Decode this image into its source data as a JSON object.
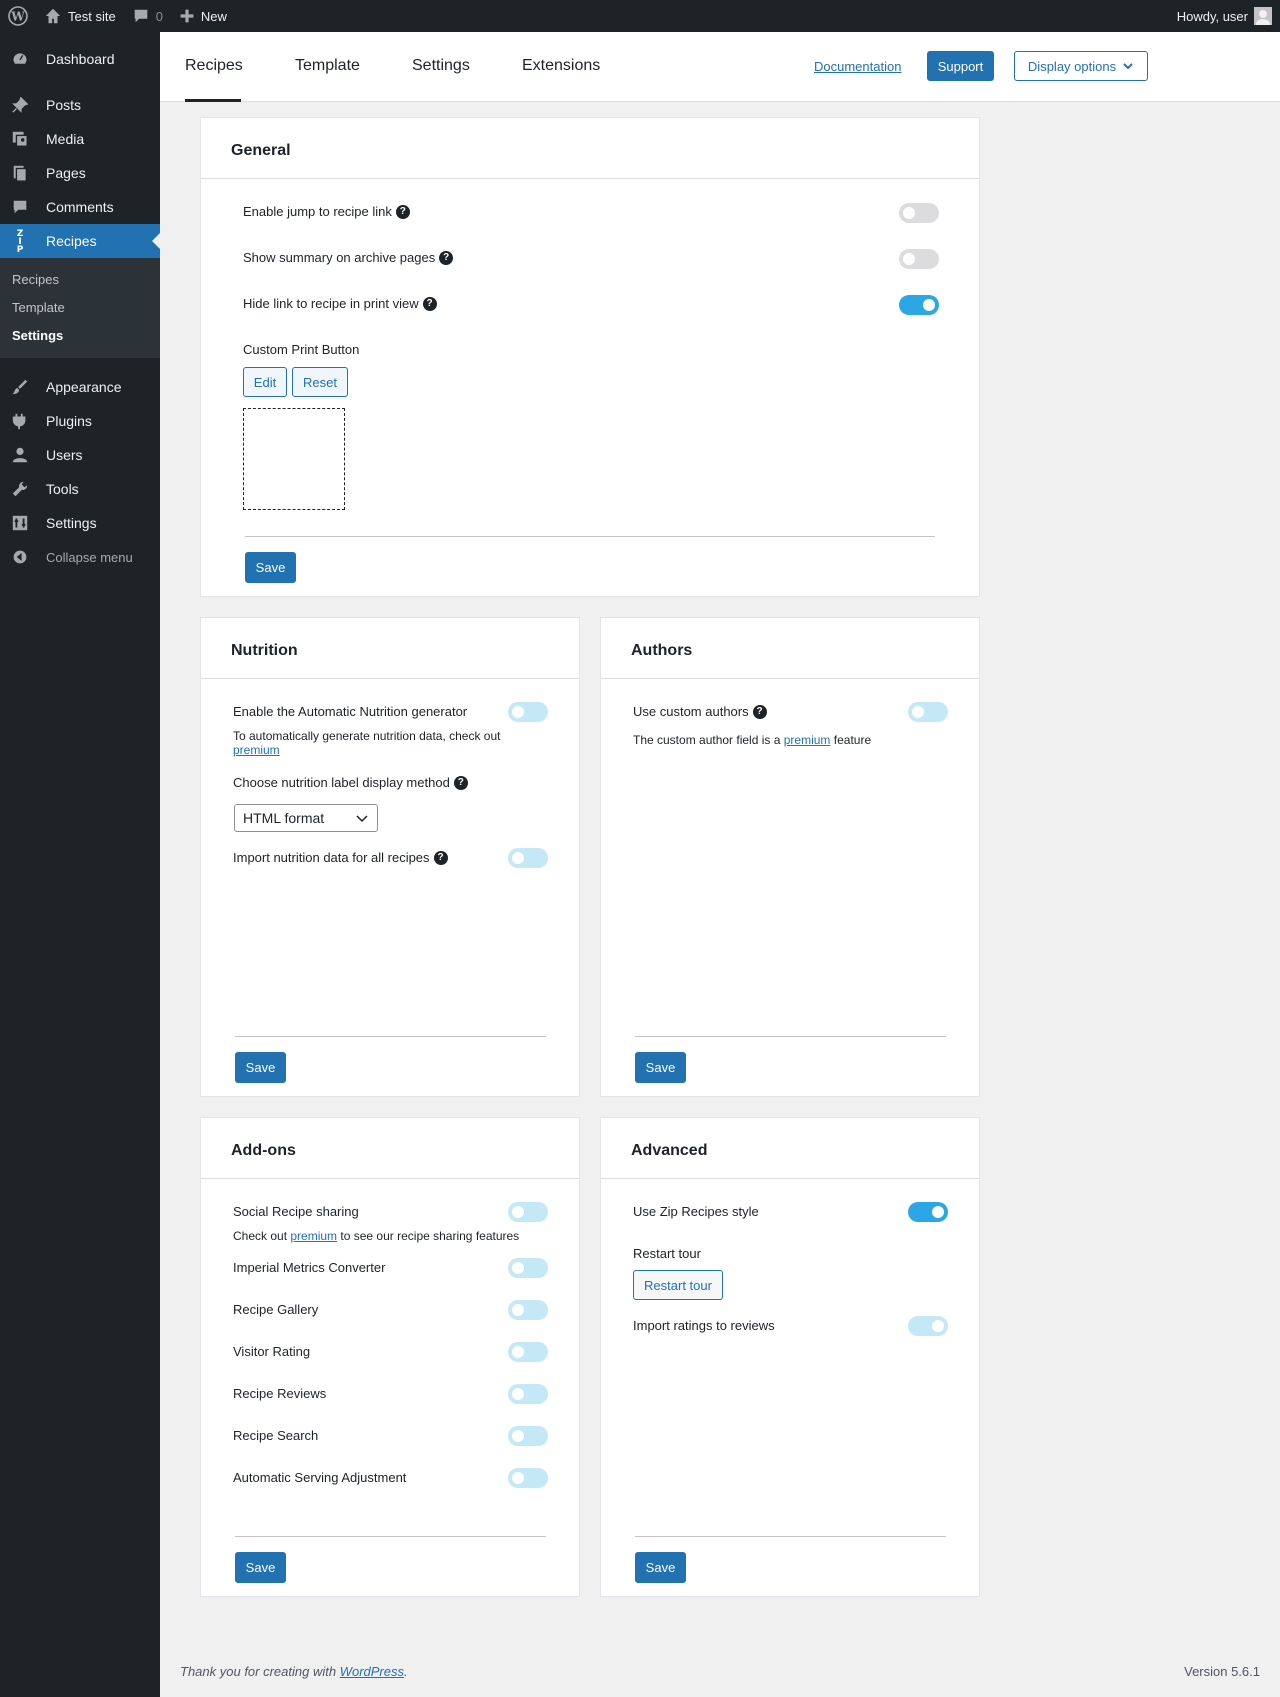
{
  "adminbar": {
    "site_name": "Test site",
    "comments_count": "0",
    "new_label": "New",
    "howdy": "Howdy, user"
  },
  "sidebar": {
    "items": [
      {
        "label": "Dashboard"
      },
      {
        "label": "Posts"
      },
      {
        "label": "Media"
      },
      {
        "label": "Pages"
      },
      {
        "label": "Comments"
      },
      {
        "label": "Recipes"
      },
      {
        "label": "Appearance"
      },
      {
        "label": "Plugins"
      },
      {
        "label": "Users"
      },
      {
        "label": "Tools"
      },
      {
        "label": "Settings"
      }
    ],
    "submenu": [
      "Recipes",
      "Template",
      "Settings"
    ],
    "collapse_label": "Collapse menu"
  },
  "header": {
    "tabs": [
      "Recipes",
      "Template",
      "Settings",
      "Extensions"
    ],
    "documentation": "Documentation",
    "support": "Support",
    "display_options": "Display options"
  },
  "general": {
    "title": "General",
    "jump_link": "Enable jump to recipe link",
    "summary_archive": "Show summary on archive pages",
    "hide_link_print": "Hide link to recipe in print view",
    "custom_print": "Custom Print Button",
    "edit": "Edit",
    "reset": "Reset",
    "save": "Save",
    "toggles": {
      "jump_link": false,
      "summary_archive": false,
      "hide_link_print": true
    }
  },
  "nutrition": {
    "title": "Nutrition",
    "auto_generator": "Enable the Automatic Nutrition generator",
    "note_prefix": "To automatically generate nutrition data, check out",
    "premium": "premium",
    "display_method": "Choose nutrition label display method",
    "select_value": "HTML format",
    "import_all": "Import nutrition data for all recipes",
    "save": "Save",
    "toggles": {
      "auto_generator": false,
      "import_all": false
    }
  },
  "authors": {
    "title": "Authors",
    "custom_authors": "Use custom authors",
    "note_prefix": "The custom author field is a",
    "premium": "premium",
    "note_suffix": "feature",
    "save": "Save",
    "toggles": {
      "custom_authors": false
    }
  },
  "addons": {
    "title": "Add-ons",
    "social": "Social Recipe sharing",
    "note_prefix": "Check out",
    "premium": "premium",
    "note_suffix": "to see our recipe sharing features",
    "items": [
      "Imperial Metrics Converter",
      "Recipe Gallery",
      "Visitor Rating",
      "Recipe Reviews",
      "Recipe Search",
      "Automatic Serving Adjustment"
    ],
    "save": "Save"
  },
  "advanced": {
    "title": "Advanced",
    "zip_style": "Use Zip Recipes style",
    "restart_tour_label": "Restart tour",
    "restart_tour_button": "Restart tour",
    "import_ratings": "Import ratings to reviews",
    "save": "Save",
    "toggles": {
      "zip_style": true,
      "import_ratings": true
    }
  },
  "footer": {
    "thanks_prefix": "Thank you for creating with",
    "wordpress": "WordPress",
    "period": ".",
    "version": "Version 5.6.1"
  },
  "colors": {
    "accent": "#2271b1",
    "sidebar": "#1d2327",
    "toggle_on": "#2ca7e6"
  }
}
